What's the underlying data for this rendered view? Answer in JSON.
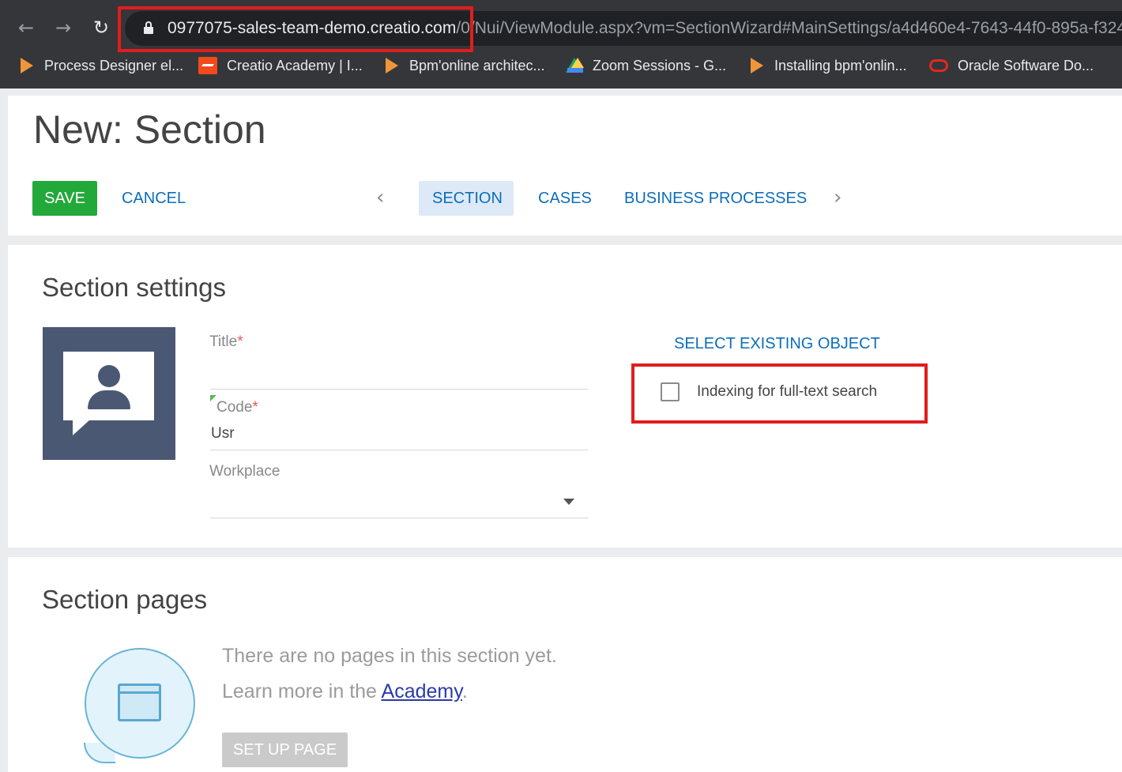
{
  "browser": {
    "url_host": "0977075-sales-team-demo.creatio.com",
    "url_path": "/0/Nui/ViewModule.aspx?vm=SectionWizard#MainSettings/a4d460e4-7643-44f0-895a-f324",
    "bookmarks": [
      {
        "label": "Process Designer el...",
        "icon": "play-triangle-icon"
      },
      {
        "label": "Creatio Academy | I...",
        "icon": "creatio-academy-icon"
      },
      {
        "label": "Bpm'online architec...",
        "icon": "play-triangle-icon"
      },
      {
        "label": "Zoom Sessions - G...",
        "icon": "google-drive-icon"
      },
      {
        "label": "Installing bpm'onlin...",
        "icon": "play-triangle-icon"
      },
      {
        "label": "Oracle Software Do...",
        "icon": "oracle-icon"
      }
    ]
  },
  "header": {
    "title": "New: Section",
    "save_label": "SAVE",
    "cancel_label": "CANCEL",
    "tabs": [
      {
        "label": "SECTION",
        "active": true
      },
      {
        "label": "CASES",
        "active": false
      },
      {
        "label": "BUSINESS PROCESSES",
        "active": false
      }
    ]
  },
  "settings": {
    "title": "Section settings",
    "fields": {
      "title_label": "Title",
      "title_value": "",
      "code_label": "Code",
      "code_value": "Usr",
      "workplace_label": "Workplace",
      "workplace_value": "",
      "required_mark": "*"
    },
    "select_existing_label": "SELECT EXISTING OBJECT",
    "indexing_label": "Indexing for full-text search",
    "indexing_checked": false
  },
  "pages": {
    "title": "Section pages",
    "empty_line1": "There are no pages in this section yet.",
    "empty_line2_prefix": "Learn more in the ",
    "academy_link": "Academy",
    "empty_line2_suffix": ".",
    "setup_label": "SET UP PAGE"
  },
  "colors": {
    "accent_blue": "#0d6eb8",
    "save_green": "#23a93a",
    "highlight_red": "#e11d1d",
    "icon_tile": "#4a5873"
  }
}
